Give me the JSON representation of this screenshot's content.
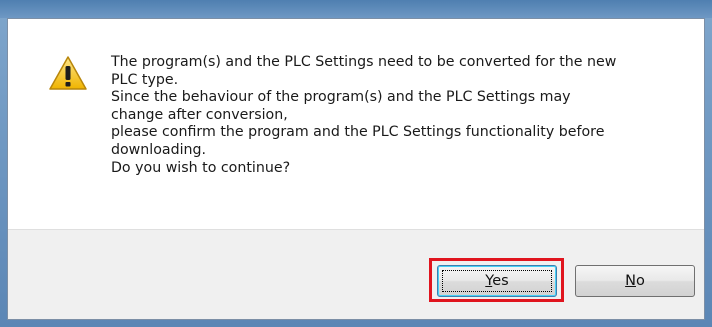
{
  "dialog": {
    "icon": "warning-icon",
    "message_lines": [
      "The program(s) and the PLC Settings need to be converted for the new",
      "PLC type.",
      "Since the behaviour of the program(s) and the PLC Settings may",
      "change after conversion,",
      "please confirm the program and the PLC Settings functionality before",
      "downloading.",
      "Do you wish to continue?"
    ]
  },
  "buttons": {
    "yes": {
      "mnemonic": "Y",
      "rest": "es"
    },
    "no": {
      "mnemonic": "N",
      "rest": "o"
    }
  },
  "colors": {
    "highlight": "#e0141e",
    "warning_fill": "#f5c518",
    "footer_bg": "#f0f0f0"
  }
}
